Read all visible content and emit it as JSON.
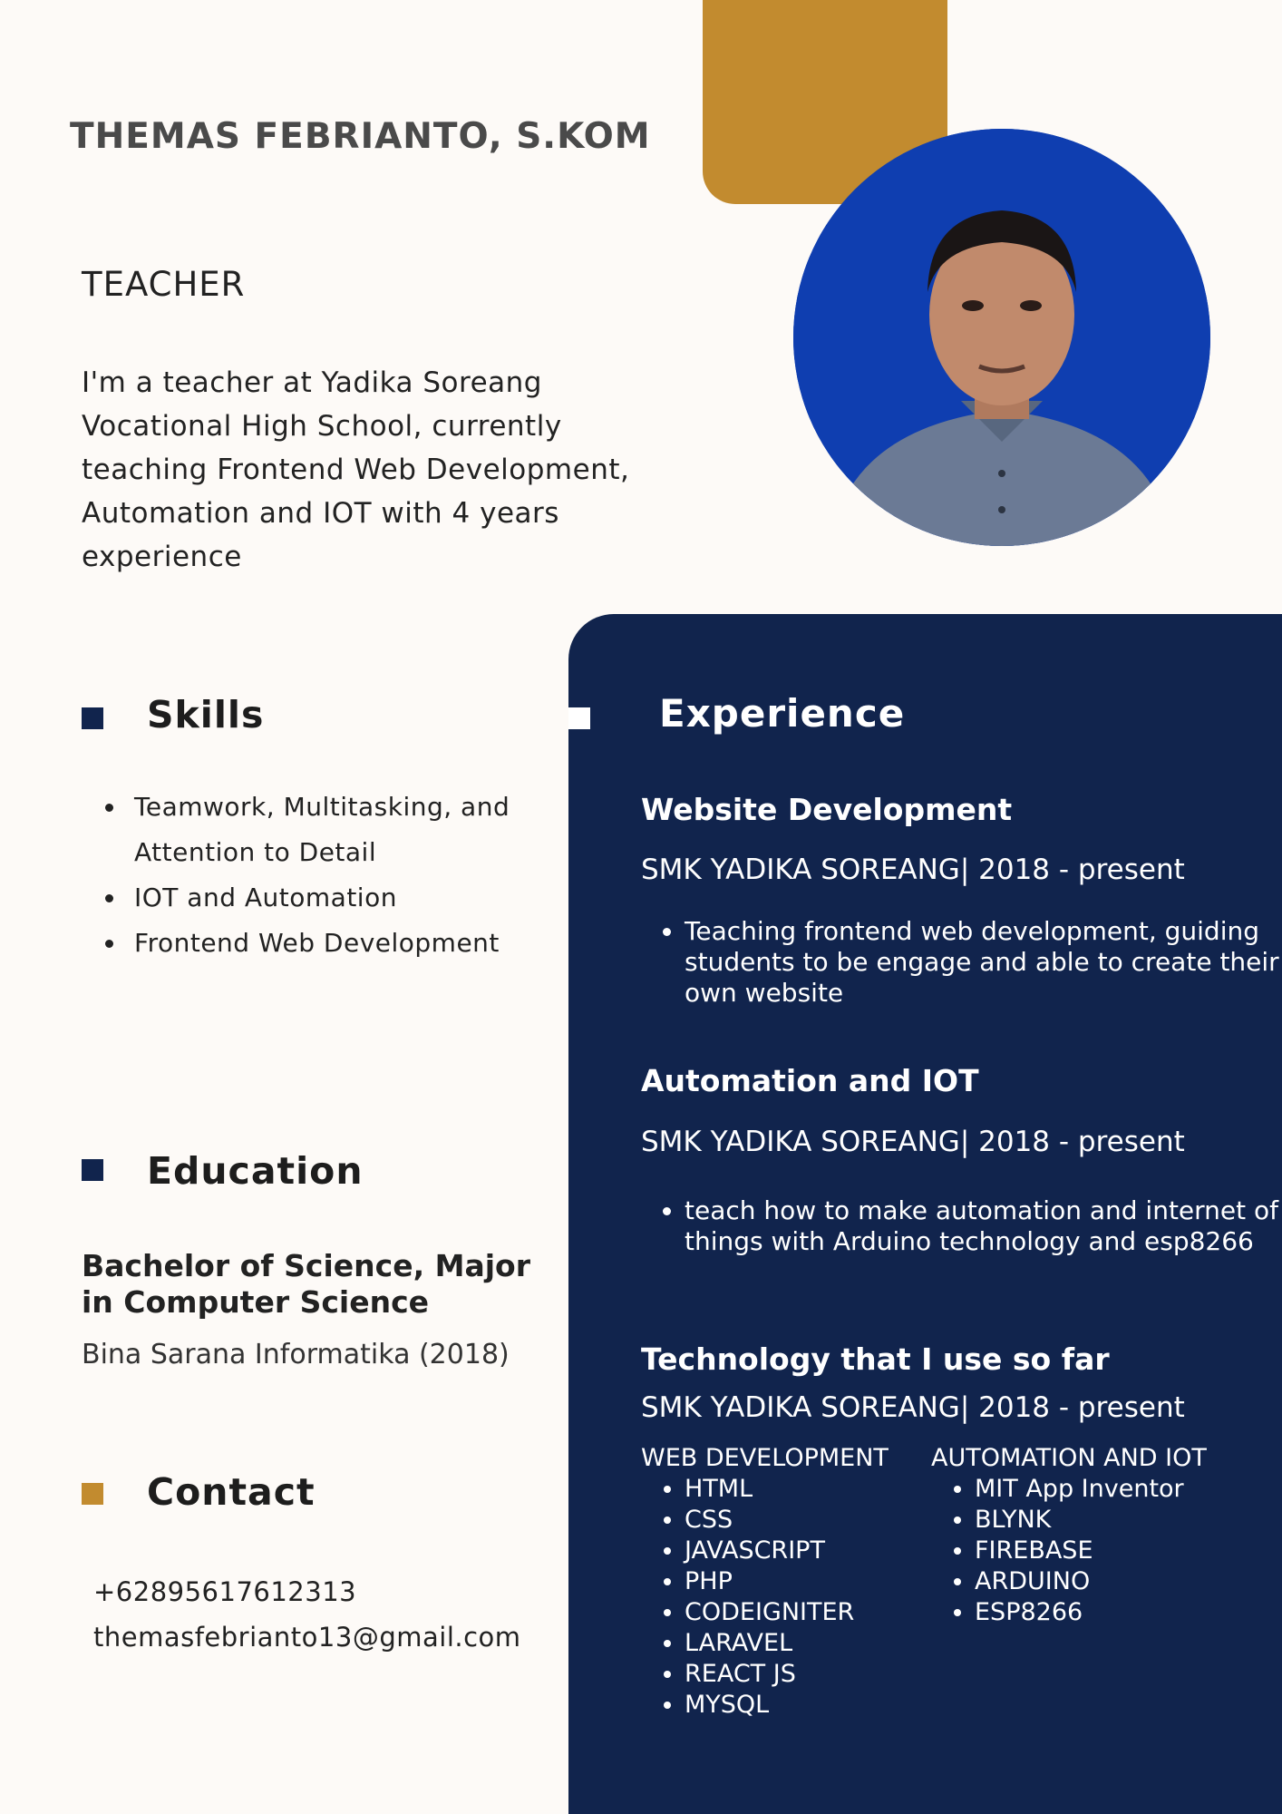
{
  "profile": {
    "name": "THEMAS FEBRIANTO, S.KOM",
    "role": "TEACHER",
    "summary": "I'm a teacher at Yadika Soreang Vocational High School, currently teaching Frontend Web Development, Automation and IOT with 4 years experience"
  },
  "skills": {
    "title": "Skills",
    "items": [
      "Teamwork, Multitasking, and Attention to Detail",
      "IOT and Automation",
      "Frontend Web Development"
    ]
  },
  "education": {
    "title": "Education",
    "degree": "Bachelor of Science, Major in Computer Science",
    "school": "Bina Sarana Informatika (2018)"
  },
  "contact": {
    "title": "Contact",
    "phone": "+62895617612313",
    "email": "themasfebrianto13@gmail.com"
  },
  "experience": {
    "title": "Experience",
    "jobs": [
      {
        "title": "Website Development",
        "meta": "SMK YADIKA SOREANG| 2018 - present",
        "duties": [
          "Teaching frontend web development, guiding students to be engage and able to create their own website"
        ]
      },
      {
        "title": "Automation and IOT",
        "meta": "SMK YADIKA SOREANG| 2018 - present",
        "duties": [
          "teach how to make automation and internet of things with Arduino technology and esp8266"
        ]
      },
      {
        "title": "Technology that I use so far",
        "meta": "SMK YADIKA SOREANG| 2018 - present",
        "columns": [
          {
            "heading": "WEB DEVELOPMENT",
            "items": [
              "HTML",
              "CSS",
              "JAVASCRIPT",
              "PHP",
              "CODEIGNITER",
              "LARAVEL",
              "REACT JS",
              "MYSQL"
            ]
          },
          {
            "heading": "AUTOMATION AND IOT",
            "items": [
              "MIT App Inventor",
              "BLYNK",
              "FIREBASE",
              "ARDUINO",
              "ESP8266"
            ]
          }
        ]
      }
    ]
  },
  "colors": {
    "background": "#fdfaf7",
    "navy": "#11244d",
    "gold": "#c28b2f",
    "photo_blue": "#0f3eb0"
  }
}
